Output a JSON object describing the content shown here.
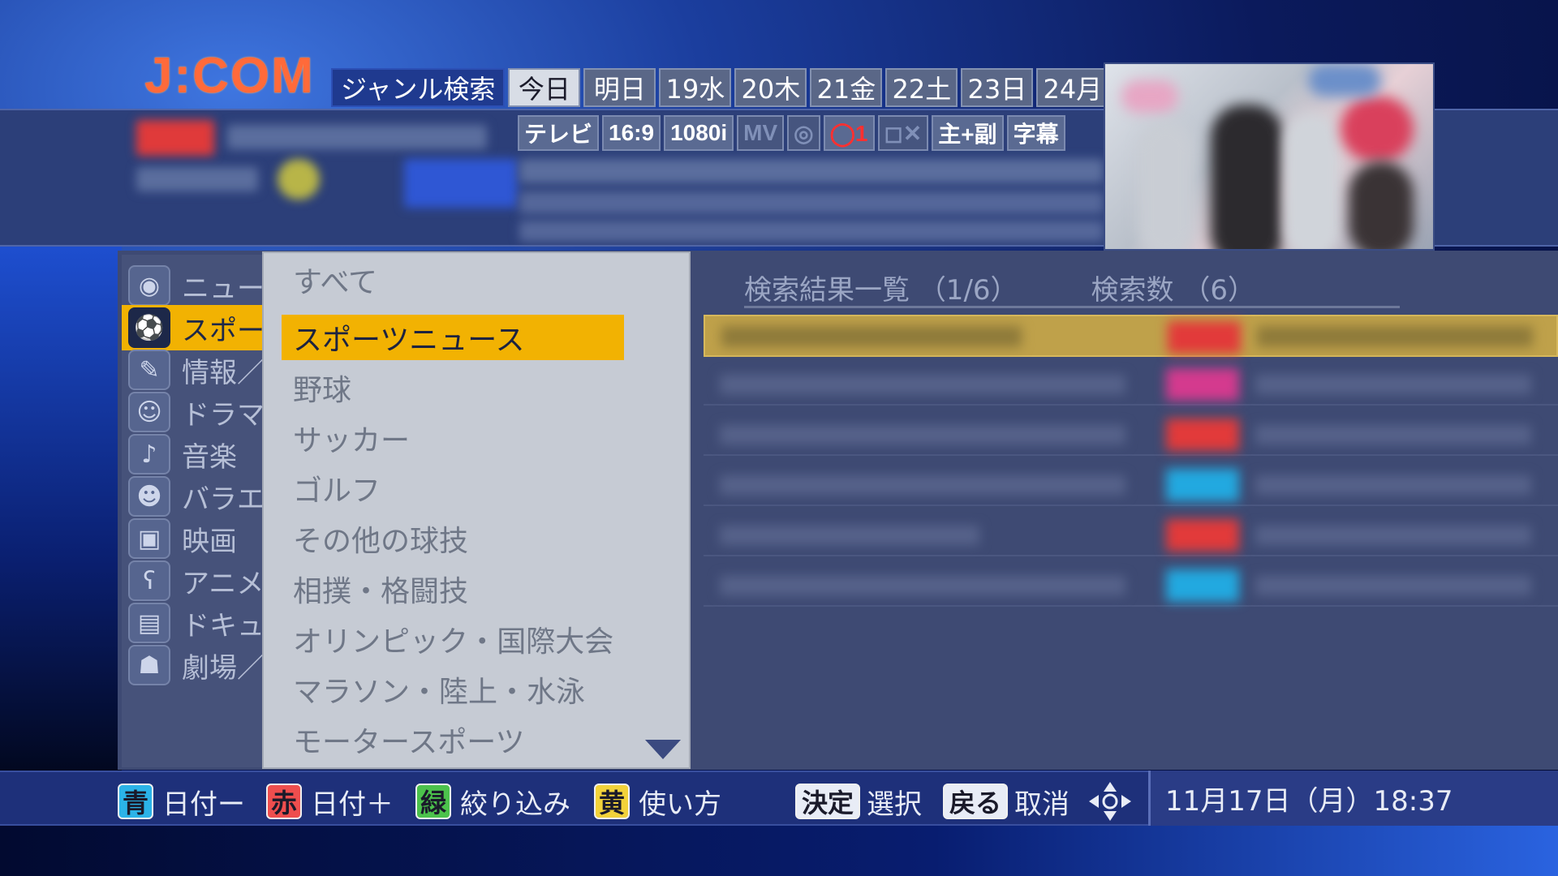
{
  "header": {
    "logo": "J:COM",
    "title": "ジャンル検索",
    "date_tabs": [
      {
        "label": "今日",
        "active": true
      },
      {
        "label": "明日",
        "active": false
      },
      {
        "label": "19水",
        "active": false
      },
      {
        "label": "20木",
        "active": false
      },
      {
        "label": "21金",
        "active": false
      },
      {
        "label": "22土",
        "active": false
      },
      {
        "label": "23日",
        "active": false
      },
      {
        "label": "24月",
        "active": false
      }
    ]
  },
  "program_info": {
    "format_badges": [
      "テレビ",
      "16:9",
      "1080i",
      "MV",
      "◎",
      "◯1",
      "◻✕",
      "主+副",
      "字幕"
    ]
  },
  "categories": [
    {
      "label": "ニュース",
      "icon": "camera-icon",
      "glyph": "◉",
      "active": false
    },
    {
      "label": "スポーツ",
      "icon": "athlete-icon",
      "glyph": "⚽",
      "active": true
    },
    {
      "label": "情報／ワイドショー",
      "icon": "info-icon",
      "glyph": "✎",
      "active": false
    },
    {
      "label": "ドラマ",
      "icon": "mask-icon",
      "glyph": "☺",
      "active": false
    },
    {
      "label": "音楽",
      "icon": "music-note-icon",
      "glyph": "♪",
      "active": false
    },
    {
      "label": "バラエティ",
      "icon": "variety-icon",
      "glyph": "☻",
      "active": false
    },
    {
      "label": "映画",
      "icon": "film-camera-icon",
      "glyph": "▣",
      "active": false
    },
    {
      "label": "アニメ",
      "icon": "bear-icon",
      "glyph": "ʕ",
      "active": false
    },
    {
      "label": "ドキュメンタリー",
      "icon": "book-icon",
      "glyph": "▤",
      "active": false
    },
    {
      "label": "劇場／公演",
      "icon": "theater-icon",
      "glyph": "☗",
      "active": false
    }
  ],
  "subgenres": [
    {
      "label": "すべて",
      "active": false
    },
    {
      "label": "スポーツニュース",
      "active": true
    },
    {
      "label": "野球",
      "active": false
    },
    {
      "label": "サッカー",
      "active": false
    },
    {
      "label": "ゴルフ",
      "active": false
    },
    {
      "label": "その他の球技",
      "active": false
    },
    {
      "label": "相撲・格闘技",
      "active": false
    },
    {
      "label": "オリンピック・国際大会",
      "active": false
    },
    {
      "label": "マラソン・陸上・水泳",
      "active": false
    },
    {
      "label": "モータースポーツ",
      "active": false
    }
  ],
  "results": {
    "list_label": "検索結果一覧",
    "page": "（1/6）",
    "count_label": "検索数",
    "count": "（6）",
    "rows": [
      {
        "badge_color": "#e23a3a"
      },
      {
        "badge_color": "#d43a8e"
      },
      {
        "badge_color": "#e23a3a"
      },
      {
        "badge_color": "#22a9e0"
      },
      {
        "badge_color": "#e23a3a"
      },
      {
        "badge_color": "#22a9e0"
      }
    ]
  },
  "footer": {
    "keys": [
      {
        "key": "青",
        "label": "日付ー",
        "color": "#2bb3e8"
      },
      {
        "key": "赤",
        "label": "日付＋",
        "color": "#ee4e4e"
      },
      {
        "key": "緑",
        "label": "絞り込み",
        "color": "#4cc24c"
      },
      {
        "key": "黄",
        "label": "使い方",
        "color": "#f2d23a"
      }
    ],
    "enter_key": "決定",
    "enter_label": "選択",
    "back_key": "戻る",
    "back_label": "取消",
    "datetime": "11月17日（月）18:37"
  }
}
